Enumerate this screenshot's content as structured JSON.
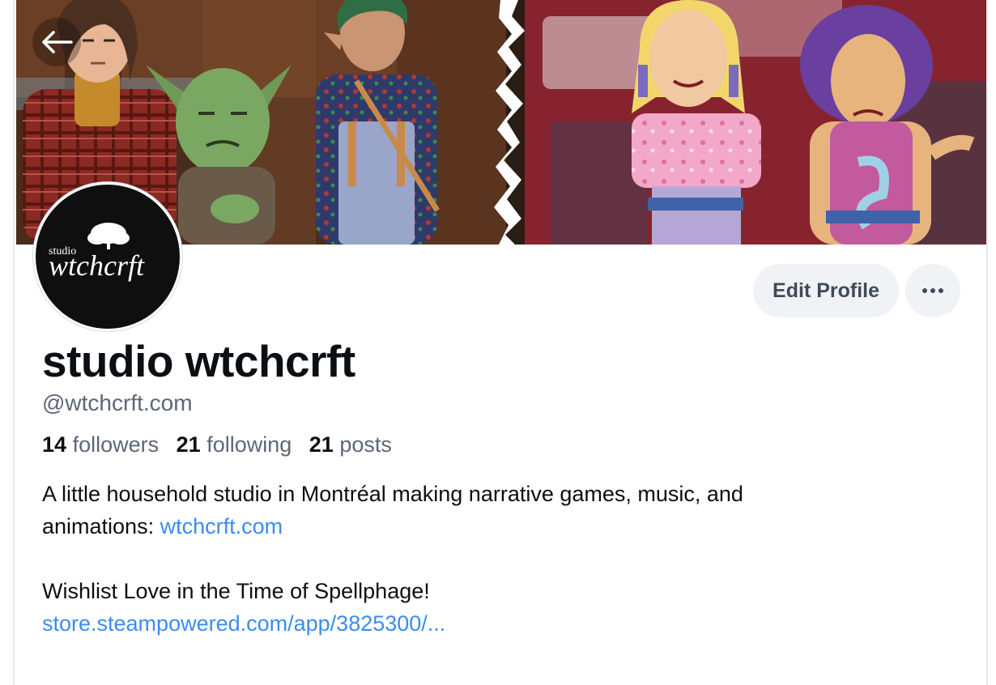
{
  "header": {
    "back_icon": "arrow-left-icon"
  },
  "profile": {
    "avatar": {
      "logo_small": "studio",
      "logo_main": "wtchcrft"
    },
    "display_name": "studio wtchcrft",
    "handle": "@wtchcrft.com",
    "stats": {
      "followers_count": "14",
      "followers_label": "followers",
      "following_count": "21",
      "following_label": "following",
      "posts_count": "21",
      "posts_label": "posts"
    },
    "bio": {
      "line1": "A little household studio in Montréal making narrative games, music, and",
      "line2_text": "animations: ",
      "line2_link": "wtchcrft.com",
      "line3": "Wishlist Love in the Time of Spellphage!",
      "line4_link": "store.steampowered.com/app/3825300/..."
    }
  },
  "actions": {
    "edit_label": "Edit Profile",
    "more_icon": "ellipsis-icon"
  },
  "colors": {
    "link": "#3b8cf1",
    "button_bg": "#f0f2f5",
    "muted_text": "#5c6776"
  }
}
